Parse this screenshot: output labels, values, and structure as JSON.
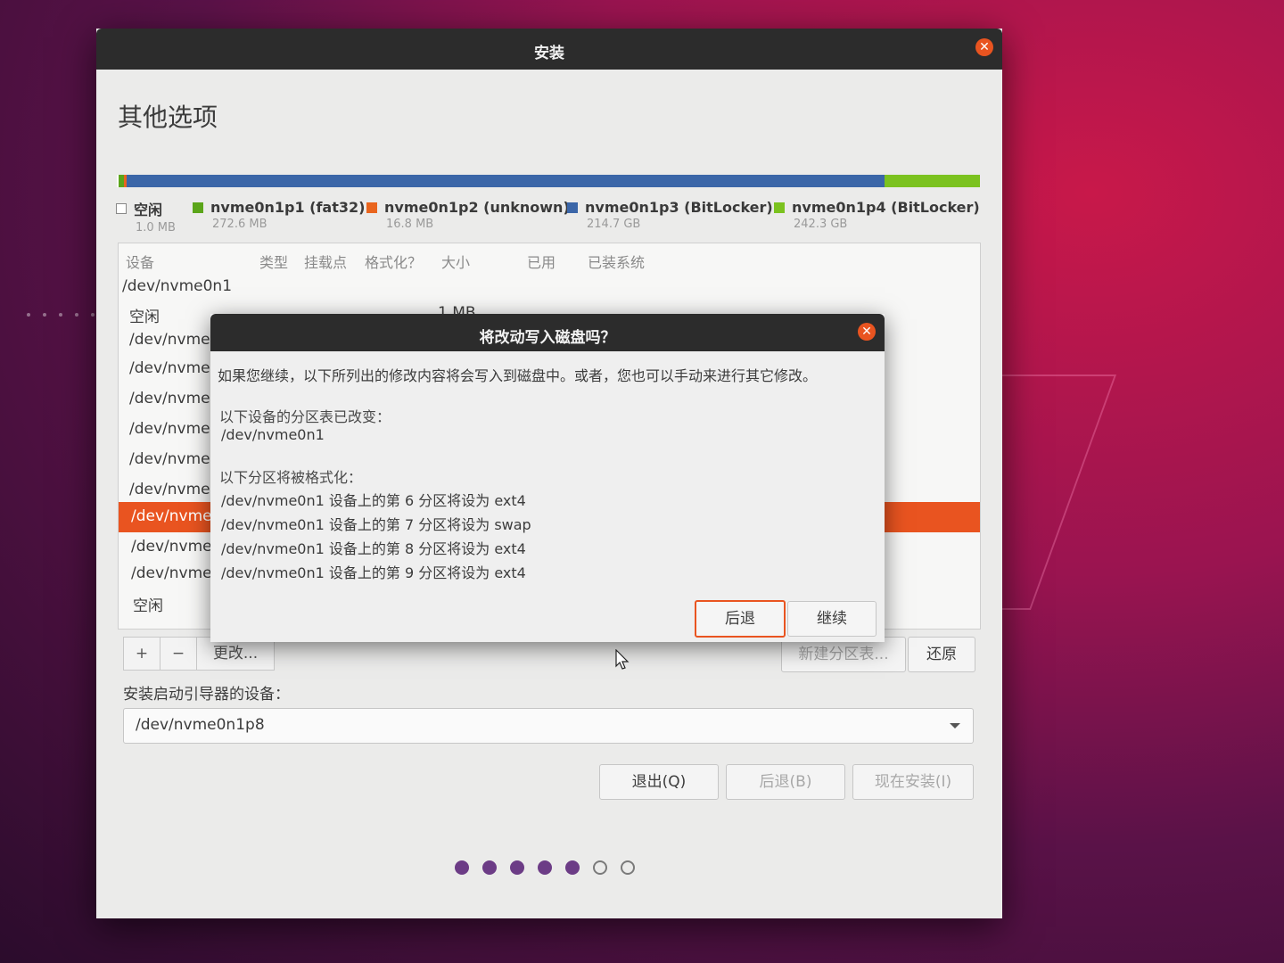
{
  "colors": {
    "accent": "#e95420",
    "fat32": "#5ba51a",
    "unknown": "#e9651e",
    "bitlocker_blue": "#3b66a8",
    "bitlocker_green": "#7bc21f",
    "progress_dot": "#6c3c86"
  },
  "window": {
    "title": "安装",
    "close_icon": "close-icon"
  },
  "page_title": "其他选项",
  "legend": [
    {
      "label": "空闲",
      "size": "1.0 MB",
      "color": "#ffffff"
    },
    {
      "label": "nvme0n1p1 (fat32)",
      "size": "272.6 MB",
      "color": "#5ba51a"
    },
    {
      "label": "nvme0n1p2 (unknown)",
      "size": "16.8 MB",
      "color": "#e9651e"
    },
    {
      "label": "nvme0n1p3 (BitLocker)",
      "size": "214.7 GB",
      "color": "#3b66a8"
    },
    {
      "label": "nvme0n1p4 (BitLocker)",
      "size": "242.3 GB",
      "color": "#7bc21f"
    }
  ],
  "table": {
    "headers": [
      "设备",
      "类型",
      "挂载点",
      "格式化？",
      "大小",
      "已用",
      "已装系统"
    ],
    "rows": [
      {
        "device": "/dev/nvme0n1"
      },
      {
        "device": "空闲",
        "size": "1 MB"
      },
      {
        "device": "/dev/nvme0"
      },
      {
        "device": "/dev/nvme0"
      },
      {
        "device": "/dev/nvme0"
      },
      {
        "device": "/dev/nvme0"
      },
      {
        "device": "/dev/nvme0"
      },
      {
        "device": "/dev/nvme0"
      },
      {
        "device": "/dev/nvme0",
        "selected": true
      },
      {
        "device": "/dev/nvme0"
      },
      {
        "device": "/dev/nvme0"
      },
      {
        "device": "空闲"
      }
    ]
  },
  "toolbar": {
    "add": "+",
    "remove": "−",
    "change": "更改...",
    "new_table": "新建分区表...",
    "revert": "还原"
  },
  "bootloader": {
    "label": "安装启动引导器的设备：",
    "value": "/dev/nvme0n1p8"
  },
  "nav": {
    "quit": "退出(Q)",
    "back": "后退(B)",
    "install_now": "现在安装(I)"
  },
  "progress": {
    "completed_steps": 5,
    "total_steps": 7
  },
  "dialog": {
    "title": "将改动写入磁盘吗？",
    "message": "如果您继续，以下所列出的修改内容将会写入到磁盘中。或者，您也可以手动来进行其它修改。",
    "table_changed_heading": "以下设备的分区表已改变：",
    "table_changed_device": "/dev/nvme0n1",
    "format_heading": "以下分区将被格式化：",
    "format_lines": [
      "/dev/nvme0n1 设备上的第 6 分区将设为 ext4",
      "/dev/nvme0n1 设备上的第 7 分区将设为 swap",
      "/dev/nvme0n1 设备上的第 8 分区将设为 ext4",
      "/dev/nvme0n1 设备上的第 9 分区将设为 ext4"
    ],
    "back_button": "后退",
    "continue_button": "继续"
  }
}
